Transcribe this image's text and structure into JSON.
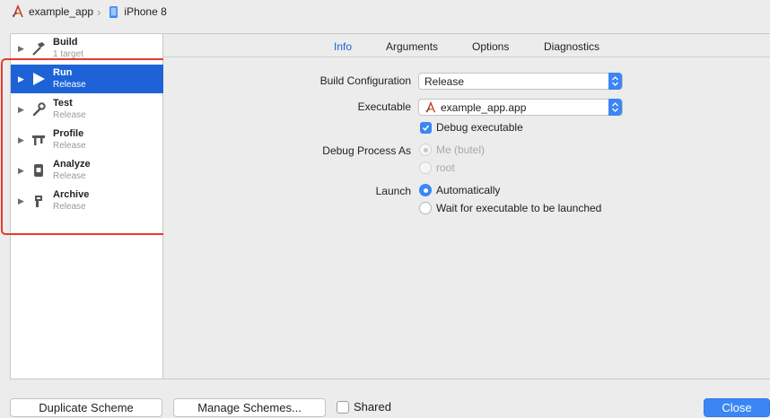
{
  "breadcrumb": {
    "project": "example_app",
    "device": "iPhone 8",
    "project_icon": "xcode-app-icon",
    "device_icon": "iphone-icon"
  },
  "sidebar": {
    "actions": [
      {
        "name": "Build",
        "sub": "1 target",
        "icon": "hammer-icon"
      },
      {
        "name": "Run",
        "sub": "Release",
        "icon": "play-icon",
        "selected": true
      },
      {
        "name": "Test",
        "sub": "Release",
        "icon": "wrench-icon"
      },
      {
        "name": "Profile",
        "sub": "Release",
        "icon": "caliper-icon"
      },
      {
        "name": "Analyze",
        "sub": "Release",
        "icon": "analyze-icon"
      },
      {
        "name": "Archive",
        "sub": "Release",
        "icon": "archive-icon"
      }
    ]
  },
  "tabs": [
    "Info",
    "Arguments",
    "Options",
    "Diagnostics"
  ],
  "active_tab": "Info",
  "form": {
    "build_configuration_label": "Build Configuration",
    "build_configuration_value": "Release",
    "executable_label": "Executable",
    "executable_value": "example_app.app",
    "debug_executable_label": "Debug executable",
    "debug_executable_checked": true,
    "debug_process_as_label": "Debug Process As",
    "debug_process_options": [
      "Me (butel)",
      "root"
    ],
    "launch_label": "Launch",
    "launch_options": [
      "Automatically",
      "Wait for executable to be launched"
    ],
    "launch_selected": "Automatically"
  },
  "footer": {
    "duplicate_scheme": "Duplicate Scheme",
    "manage_schemes": "Manage Schemes...",
    "shared_label": "Shared",
    "close": "Close"
  },
  "colors": {
    "accent": "#3b86f5",
    "selection": "#1d63d7",
    "annotation": "#e8392c"
  }
}
